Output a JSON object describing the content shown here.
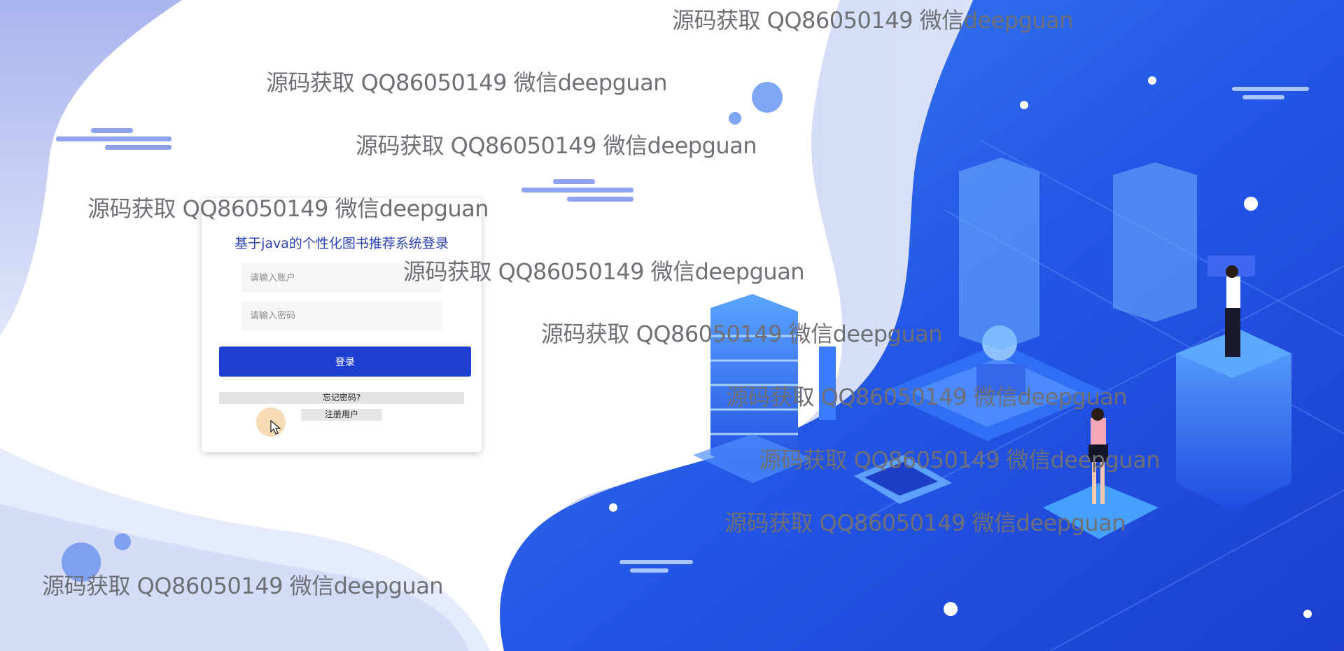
{
  "login": {
    "title": "基于java的个性化图书推荐系统登录",
    "username_placeholder": "请输入账户",
    "password_placeholder": "请输入密码",
    "login_label": "登录",
    "forgot_label": "忘记密码?",
    "register_label": "注册用户"
  },
  "watermarks": [
    "源码获取 QQ86050149 微信deepguan",
    "源码获取 QQ86050149 微信deepguan",
    "源码获取 QQ86050149 微信deepguan",
    "源码获取 QQ86050149 微信deepguan",
    "源码获取 QQ86050149 微信deepguan",
    "源码获取 QQ86050149 微信deepguan",
    "源码获取 QQ86050149 微信deepguan",
    "源码获取 QQ86050149 微信deepguan",
    "源码获取 QQ86050149 微信deepguan",
    "源码获取 QQ86050149 微信deepguan"
  ],
  "colors": {
    "accent": "#1c3fcf",
    "title": "#2a40b5",
    "background_blue": "#2a5be8"
  }
}
